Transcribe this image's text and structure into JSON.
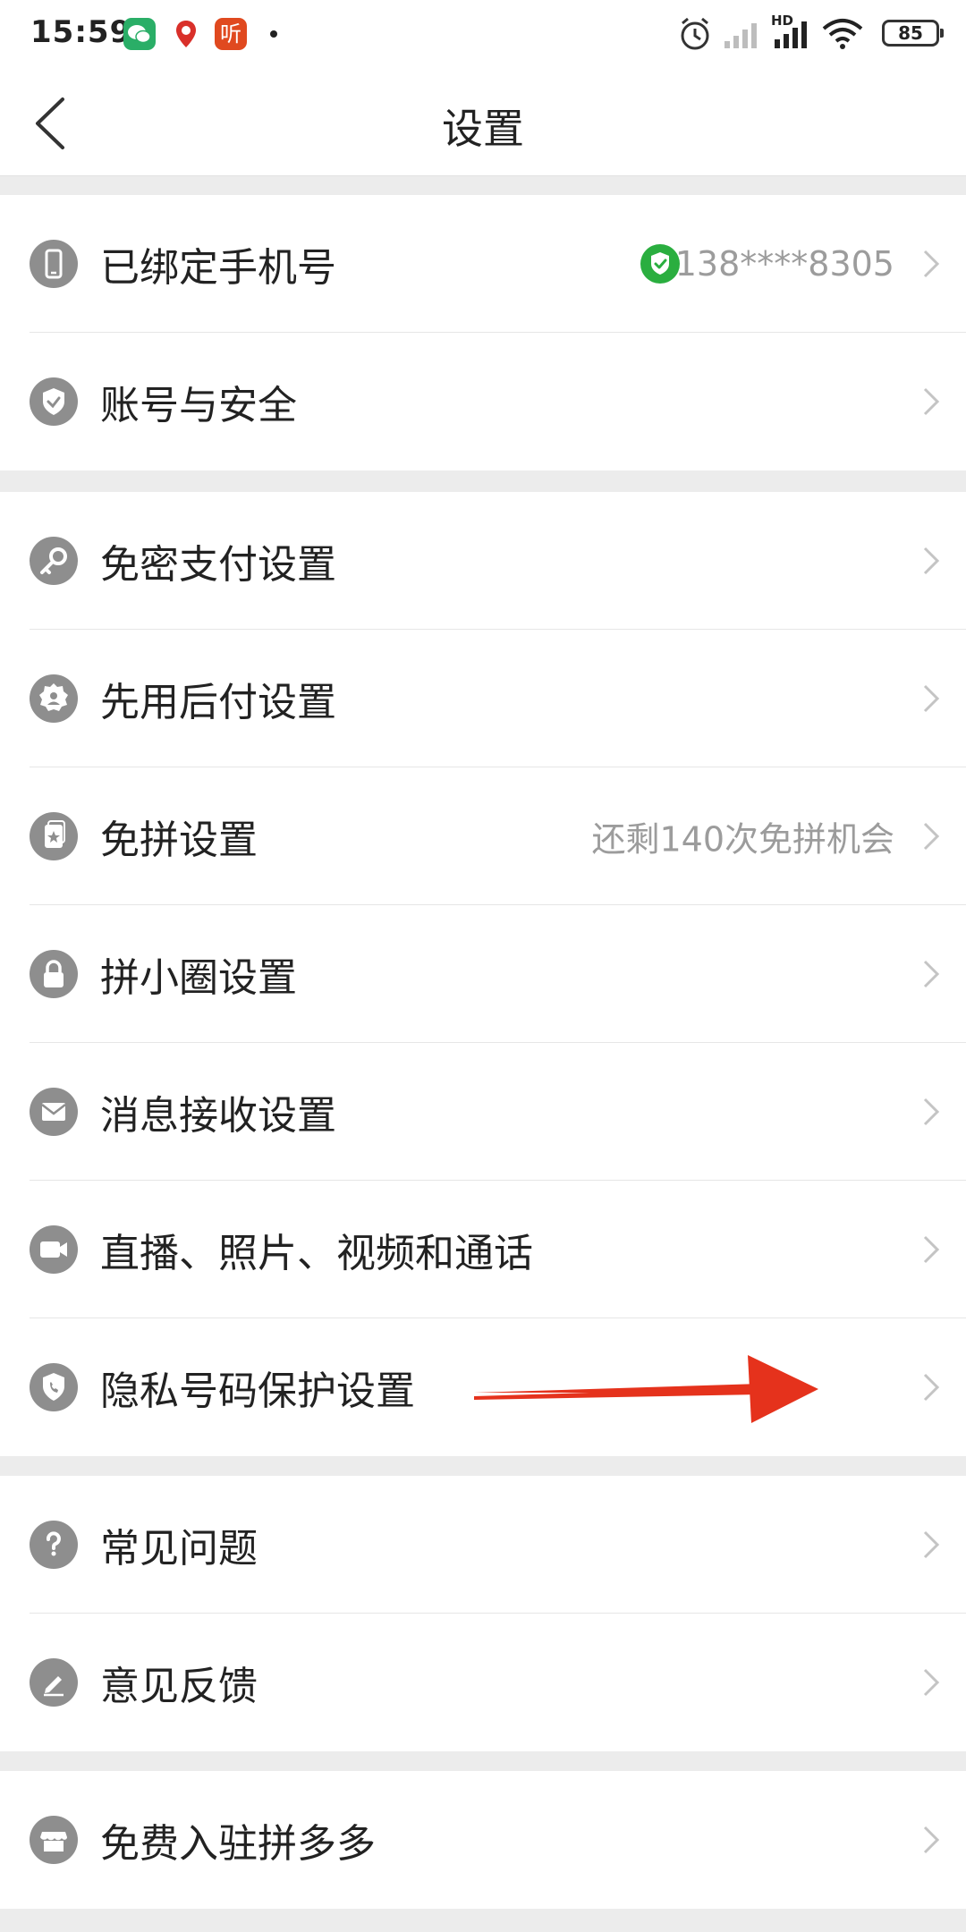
{
  "status_bar": {
    "time": "15:59",
    "battery": "85",
    "network_tag": "HD",
    "listen_app_label": "听"
  },
  "nav": {
    "title": "设置"
  },
  "groups": [
    {
      "rows": [
        {
          "label": "已绑定手机号",
          "value": "138****8305",
          "icon": "phone-icon",
          "verified": true
        },
        {
          "label": "账号与安全",
          "value": "",
          "icon": "shield-check-icon"
        }
      ]
    },
    {
      "rows": [
        {
          "label": "免密支付设置",
          "value": "",
          "icon": "key-icon"
        },
        {
          "label": "先用后付设置",
          "value": "",
          "icon": "badge-user-icon"
        },
        {
          "label": "免拼设置",
          "value": "还剩140次免拼机会",
          "icon": "card-star-icon"
        },
        {
          "label": "拼小圈设置",
          "value": "",
          "icon": "lock-icon"
        },
        {
          "label": "消息接收设置",
          "value": "",
          "icon": "envelope-icon"
        },
        {
          "label": "直播、照片、视频和通话",
          "value": "",
          "icon": "video-camera-icon"
        },
        {
          "label": "隐私号码保护设置",
          "value": "",
          "icon": "shield-phone-icon"
        }
      ]
    },
    {
      "rows": [
        {
          "label": "常见问题",
          "value": "",
          "icon": "question-icon"
        },
        {
          "label": "意见反馈",
          "value": "",
          "icon": "pen-icon"
        }
      ]
    },
    {
      "rows": [
        {
          "label": "免费入驻拼多多",
          "value": "",
          "icon": "store-icon"
        }
      ]
    }
  ],
  "colors": {
    "verified": "#2aae3f",
    "annotation_arrow": "#e5321c",
    "icon_bg": "#8e8e8e"
  }
}
